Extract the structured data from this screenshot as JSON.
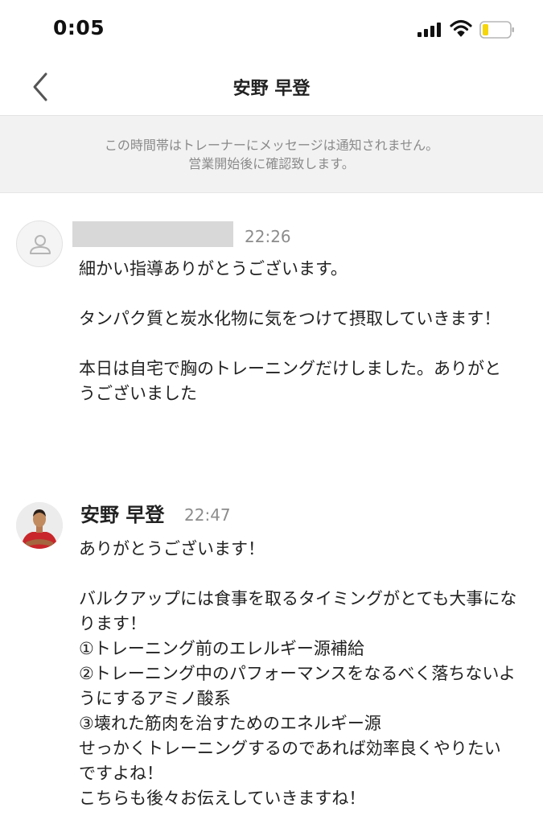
{
  "status_bar": {
    "time": "0:05",
    "icons": [
      "signal-icon",
      "wifi-icon",
      "battery-icon"
    ]
  },
  "header": {
    "title": "安野 早登",
    "back_icon": "chevron-left-icon"
  },
  "notice": {
    "line1": "この時間帯はトレーナーにメッセージは通知されません。",
    "line2": "営業開始後に確認致します。"
  },
  "messages": [
    {
      "sender": "",
      "sender_redacted": true,
      "avatar": "default-user-icon",
      "time": "22:26",
      "text": "細かい指導ありがとうございます。\n\nタンパク質と炭水化物に気をつけて摂取していきます！\n\n本日は自宅で胸のトレーニングだけしました。ありがとうございました"
    },
    {
      "sender": "安野 早登",
      "avatar": "trainer-photo",
      "time": "22:47",
      "text": "ありがとうございます！\n\nバルクアップには食事を取るタイミングがとても大事になります！\n①トレーニング前のエレルギー源補給\n②トレーニング中のパフォーマンスをなるべく落ちないようにするアミノ酸系\n③壊れた筋肉を治すためのエネルギー源\nせっかくトレーニングするのであれば効率良くやりたいですよね！\nこちらも後々お伝えしていきますね！"
    }
  ],
  "colors": {
    "background": "#ffffff",
    "banner_bg": "#f2f2f2",
    "muted_text": "#8c8c8c",
    "battery_fill": "#f5d60a"
  }
}
